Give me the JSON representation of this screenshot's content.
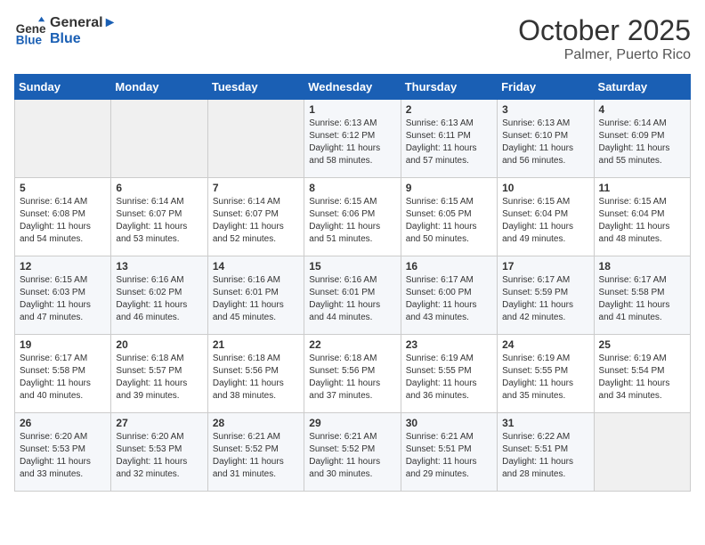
{
  "logo": {
    "line1": "General",
    "line2": "Blue"
  },
  "title": "October 2025",
  "location": "Palmer, Puerto Rico",
  "days_of_week": [
    "Sunday",
    "Monday",
    "Tuesday",
    "Wednesday",
    "Thursday",
    "Friday",
    "Saturday"
  ],
  "weeks": [
    [
      {
        "day": "",
        "info": ""
      },
      {
        "day": "",
        "info": ""
      },
      {
        "day": "",
        "info": ""
      },
      {
        "day": "1",
        "info": "Sunrise: 6:13 AM\nSunset: 6:12 PM\nDaylight: 11 hours\nand 58 minutes."
      },
      {
        "day": "2",
        "info": "Sunrise: 6:13 AM\nSunset: 6:11 PM\nDaylight: 11 hours\nand 57 minutes."
      },
      {
        "day": "3",
        "info": "Sunrise: 6:13 AM\nSunset: 6:10 PM\nDaylight: 11 hours\nand 56 minutes."
      },
      {
        "day": "4",
        "info": "Sunrise: 6:14 AM\nSunset: 6:09 PM\nDaylight: 11 hours\nand 55 minutes."
      }
    ],
    [
      {
        "day": "5",
        "info": "Sunrise: 6:14 AM\nSunset: 6:08 PM\nDaylight: 11 hours\nand 54 minutes."
      },
      {
        "day": "6",
        "info": "Sunrise: 6:14 AM\nSunset: 6:07 PM\nDaylight: 11 hours\nand 53 minutes."
      },
      {
        "day": "7",
        "info": "Sunrise: 6:14 AM\nSunset: 6:07 PM\nDaylight: 11 hours\nand 52 minutes."
      },
      {
        "day": "8",
        "info": "Sunrise: 6:15 AM\nSunset: 6:06 PM\nDaylight: 11 hours\nand 51 minutes."
      },
      {
        "day": "9",
        "info": "Sunrise: 6:15 AM\nSunset: 6:05 PM\nDaylight: 11 hours\nand 50 minutes."
      },
      {
        "day": "10",
        "info": "Sunrise: 6:15 AM\nSunset: 6:04 PM\nDaylight: 11 hours\nand 49 minutes."
      },
      {
        "day": "11",
        "info": "Sunrise: 6:15 AM\nSunset: 6:04 PM\nDaylight: 11 hours\nand 48 minutes."
      }
    ],
    [
      {
        "day": "12",
        "info": "Sunrise: 6:15 AM\nSunset: 6:03 PM\nDaylight: 11 hours\nand 47 minutes."
      },
      {
        "day": "13",
        "info": "Sunrise: 6:16 AM\nSunset: 6:02 PM\nDaylight: 11 hours\nand 46 minutes."
      },
      {
        "day": "14",
        "info": "Sunrise: 6:16 AM\nSunset: 6:01 PM\nDaylight: 11 hours\nand 45 minutes."
      },
      {
        "day": "15",
        "info": "Sunrise: 6:16 AM\nSunset: 6:01 PM\nDaylight: 11 hours\nand 44 minutes."
      },
      {
        "day": "16",
        "info": "Sunrise: 6:17 AM\nSunset: 6:00 PM\nDaylight: 11 hours\nand 43 minutes."
      },
      {
        "day": "17",
        "info": "Sunrise: 6:17 AM\nSunset: 5:59 PM\nDaylight: 11 hours\nand 42 minutes."
      },
      {
        "day": "18",
        "info": "Sunrise: 6:17 AM\nSunset: 5:58 PM\nDaylight: 11 hours\nand 41 minutes."
      }
    ],
    [
      {
        "day": "19",
        "info": "Sunrise: 6:17 AM\nSunset: 5:58 PM\nDaylight: 11 hours\nand 40 minutes."
      },
      {
        "day": "20",
        "info": "Sunrise: 6:18 AM\nSunset: 5:57 PM\nDaylight: 11 hours\nand 39 minutes."
      },
      {
        "day": "21",
        "info": "Sunrise: 6:18 AM\nSunset: 5:56 PM\nDaylight: 11 hours\nand 38 minutes."
      },
      {
        "day": "22",
        "info": "Sunrise: 6:18 AM\nSunset: 5:56 PM\nDaylight: 11 hours\nand 37 minutes."
      },
      {
        "day": "23",
        "info": "Sunrise: 6:19 AM\nSunset: 5:55 PM\nDaylight: 11 hours\nand 36 minutes."
      },
      {
        "day": "24",
        "info": "Sunrise: 6:19 AM\nSunset: 5:55 PM\nDaylight: 11 hours\nand 35 minutes."
      },
      {
        "day": "25",
        "info": "Sunrise: 6:19 AM\nSunset: 5:54 PM\nDaylight: 11 hours\nand 34 minutes."
      }
    ],
    [
      {
        "day": "26",
        "info": "Sunrise: 6:20 AM\nSunset: 5:53 PM\nDaylight: 11 hours\nand 33 minutes."
      },
      {
        "day": "27",
        "info": "Sunrise: 6:20 AM\nSunset: 5:53 PM\nDaylight: 11 hours\nand 32 minutes."
      },
      {
        "day": "28",
        "info": "Sunrise: 6:21 AM\nSunset: 5:52 PM\nDaylight: 11 hours\nand 31 minutes."
      },
      {
        "day": "29",
        "info": "Sunrise: 6:21 AM\nSunset: 5:52 PM\nDaylight: 11 hours\nand 30 minutes."
      },
      {
        "day": "30",
        "info": "Sunrise: 6:21 AM\nSunset: 5:51 PM\nDaylight: 11 hours\nand 29 minutes."
      },
      {
        "day": "31",
        "info": "Sunrise: 6:22 AM\nSunset: 5:51 PM\nDaylight: 11 hours\nand 28 minutes."
      },
      {
        "day": "",
        "info": ""
      }
    ]
  ]
}
